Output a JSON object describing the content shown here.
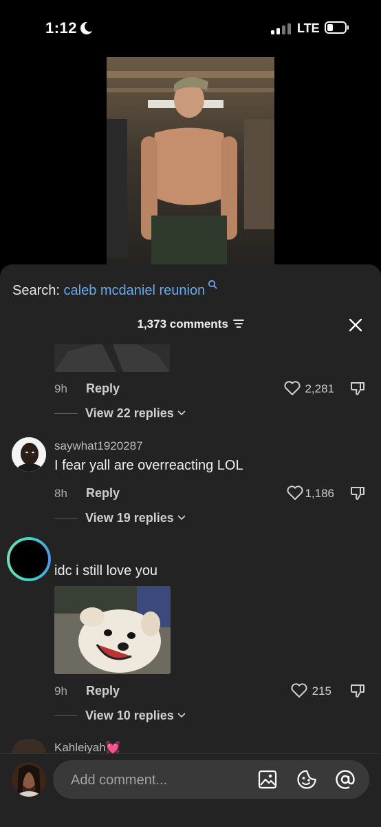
{
  "status_bar": {
    "time": "1:12",
    "network": "LTE"
  },
  "video": {
    "description_icon": "video-frame"
  },
  "comments_sheet": {
    "search_prefix": "Search:",
    "search_term": "caleb mcdaniel reunion",
    "comment_count": "1,373 comments",
    "close_icon": "close-icon",
    "sort_icon": "filter-icon",
    "comments": [
      {
        "age": "9h",
        "reply_label": "Reply",
        "likes": "2,281",
        "view_replies": "View 22 replies"
      },
      {
        "username": "saywhat1920287",
        "text": "I fear yall are overreacting LOL",
        "age": "8h",
        "reply_label": "Reply",
        "likes": "1,186",
        "view_replies": "View 19 replies"
      },
      {
        "text": "idc i still love you",
        "age": "9h",
        "reply_label": "Reply",
        "likes": "215",
        "view_replies": "View 10 replies"
      },
      {
        "username": "Kahleiyah💓"
      }
    ]
  },
  "composer": {
    "placeholder": "Add comment...",
    "icons": [
      "image-icon",
      "emoji-icon",
      "mention-icon"
    ]
  },
  "colors": {
    "sheet_bg": "#232323",
    "link": "#6aa8ee",
    "input_bg": "#393939"
  }
}
